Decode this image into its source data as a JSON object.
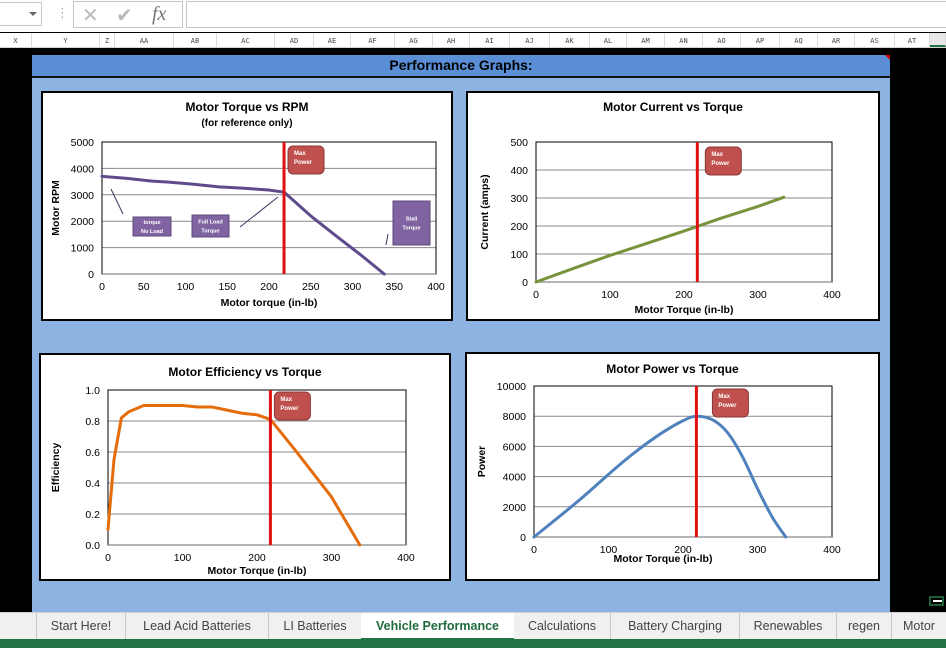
{
  "formula_bar": {
    "name_box_value": "",
    "cancel_icon": "x-icon",
    "enter_icon": "check-icon",
    "function_icon": "fx-icon",
    "formula_value": ""
  },
  "column_headers": [
    "X",
    "Y",
    "Z",
    "AA",
    "AB",
    "AC",
    "AD",
    "AE",
    "AF",
    "AG",
    "AH",
    "AI",
    "AJ",
    "AK",
    "AL",
    "AM",
    "AN",
    "AO",
    "AP",
    "AQ",
    "AR",
    "AS",
    "AT"
  ],
  "section_title": "Performance Graphs:",
  "annotation_colors": {
    "max_power_line": "#e01010",
    "max_power_box": "#c0504d",
    "callout_box": "#8064a2"
  },
  "chart_data": [
    {
      "type": "line",
      "title": "Motor Torque vs RPM",
      "subtitle": "(for reference only)",
      "xlabel": "Motor torque (in-lb)",
      "ylabel": "Motor RPM",
      "xlim": [
        0,
        400
      ],
      "ylim": [
        0,
        5000
      ],
      "xticks": [
        "0",
        "50",
        "100",
        "150",
        "200",
        "250",
        "300",
        "350",
        "400"
      ],
      "yticks": [
        "0",
        "1000",
        "2000",
        "3000",
        "4000",
        "5000"
      ],
      "grid": true,
      "series": [
        {
          "name": "RPM",
          "color": "#5f4b8b",
          "x": [
            0,
            30,
            60,
            80,
            110,
            140,
            170,
            200,
            218,
            250,
            280,
            310,
            338
          ],
          "y": [
            3700,
            3620,
            3520,
            3480,
            3400,
            3300,
            3250,
            3180,
            3100,
            2200,
            1450,
            720,
            0
          ]
        }
      ],
      "vline": {
        "x": 218,
        "label": "Max Power"
      },
      "annotations": [
        {
          "text_lines": [
            "torque",
            "No Load"
          ],
          "style": "callout"
        },
        {
          "text_lines": [
            "Full Load",
            "Torque"
          ],
          "style": "callout"
        },
        {
          "text_lines": [
            "Stall",
            "Torque"
          ],
          "style": "callout"
        },
        {
          "text_lines": [
            "Max",
            "Power"
          ],
          "style": "max-power"
        }
      ]
    },
    {
      "type": "line",
      "title": "Motor Current vs Torque",
      "xlabel": "Motor Torque (in-lb)",
      "ylabel": "Current (amps)",
      "xlim": [
        0,
        400
      ],
      "ylim": [
        0,
        500
      ],
      "xticks": [
        "0",
        "100",
        "200",
        "300",
        "400"
      ],
      "yticks": [
        "0",
        "100",
        "200",
        "300",
        "400",
        "500"
      ],
      "grid": true,
      "series": [
        {
          "name": "Current",
          "color": "#77933c",
          "x": [
            0,
            50,
            100,
            150,
            200,
            250,
            300,
            335
          ],
          "y": [
            0,
            48,
            95,
            138,
            182,
            228,
            270,
            303
          ]
        }
      ],
      "vline": {
        "x": 218,
        "label": "Max Power"
      },
      "annotations": [
        {
          "text_lines": [
            "Max",
            "Power"
          ],
          "style": "max-power"
        }
      ]
    },
    {
      "type": "line",
      "title": "Motor Efficiency vs Torque",
      "xlabel": "Motor Torque (in-lb)",
      "ylabel": "Efficiency",
      "xlim": [
        0,
        400
      ],
      "ylim": [
        0,
        1.0
      ],
      "xticks": [
        "0",
        "100",
        "200",
        "300",
        "400"
      ],
      "yticks": [
        "0.0",
        "0.2",
        "0.4",
        "0.6",
        "0.8",
        "1.0"
      ],
      "grid": true,
      "series": [
        {
          "name": "Efficiency",
          "color": "#e46c0a",
          "x": [
            0,
            8,
            18,
            28,
            48,
            80,
            100,
            120,
            140,
            160,
            180,
            200,
            218,
            250,
            300,
            338
          ],
          "y": [
            0.1,
            0.55,
            0.82,
            0.86,
            0.9,
            0.9,
            0.9,
            0.89,
            0.89,
            0.87,
            0.85,
            0.84,
            0.81,
            0.62,
            0.31,
            0.0
          ]
        }
      ],
      "vline": {
        "x": 218,
        "label": "Max Power"
      },
      "annotations": [
        {
          "text_lines": [
            "Max",
            "Power"
          ],
          "style": "max-power"
        }
      ]
    },
    {
      "type": "line",
      "title": "Motor Power vs Torque",
      "xlabel": "Motor Torque (in-lb)",
      "ylabel": "Power",
      "xlim": [
        0,
        400
      ],
      "ylim": [
        0,
        10000
      ],
      "xticks": [
        "0",
        "100",
        "200",
        "300",
        "400"
      ],
      "yticks": [
        "0",
        "2000",
        "4000",
        "6000",
        "8000",
        "10000"
      ],
      "grid": true,
      "series": [
        {
          "name": "Power",
          "color": "#4f81bd",
          "x": [
            0,
            25,
            50,
            75,
            100,
            125,
            150,
            175,
            200,
            218,
            240,
            260,
            280,
            300,
            320,
            338
          ],
          "y": [
            0,
            1000,
            2000,
            3050,
            4150,
            5200,
            6150,
            7000,
            7700,
            8000,
            7750,
            6900,
            5300,
            3200,
            1300,
            0
          ]
        }
      ],
      "vline": {
        "x": 218,
        "label": "Max Power"
      },
      "annotations": [
        {
          "text_lines": [
            "Max",
            "Power"
          ],
          "style": "max-power"
        }
      ]
    }
  ],
  "sheet_tabs": [
    {
      "label": "Start Here!",
      "active": false
    },
    {
      "label": "Lead Acid Batteries",
      "active": false
    },
    {
      "label": "LI Batteries",
      "active": false
    },
    {
      "label": "Vehicle Performance",
      "active": true
    },
    {
      "label": "Calculations",
      "active": false
    },
    {
      "label": "Battery Charging",
      "active": false
    },
    {
      "label": "Renewables",
      "active": false
    },
    {
      "label": "regen",
      "active": false
    },
    {
      "label": "Motor",
      "active": false
    }
  ]
}
